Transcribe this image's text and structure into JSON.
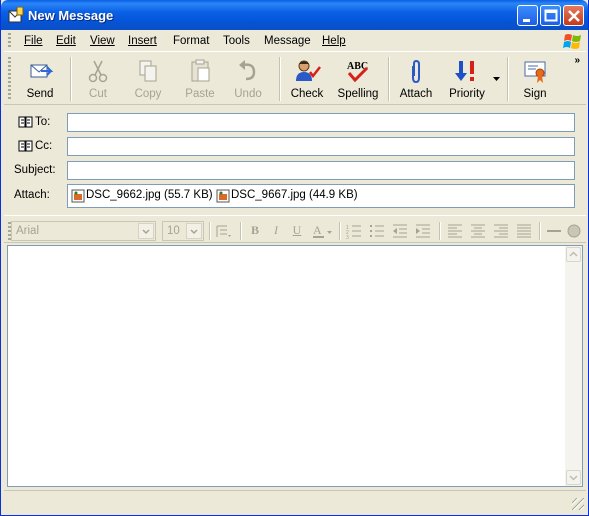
{
  "window": {
    "title": "New Message"
  },
  "menu": [
    "File",
    "Edit",
    "View",
    "Insert",
    "Format",
    "Tools",
    "Message",
    "Help"
  ],
  "toolbar": {
    "send": "Send",
    "cut": "Cut",
    "copy": "Copy",
    "paste": "Paste",
    "undo": "Undo",
    "check": "Check",
    "spelling": "Spelling",
    "attach": "Attach",
    "priority": "Priority",
    "sign": "Sign"
  },
  "header": {
    "to_label": "To:",
    "cc_label": "Cc:",
    "subject_label": "Subject:",
    "attach_label": "Attach:",
    "to_value": "",
    "cc_value": "",
    "subject_value": ""
  },
  "attachments": [
    {
      "name": "DSC_9662.jpg (55.7 KB)"
    },
    {
      "name": "DSC_9667.jpg (44.9 KB)"
    }
  ],
  "format": {
    "font": "Arial",
    "size": "10"
  },
  "icons": {
    "send": "send-icon",
    "cut": "scissors-icon",
    "copy": "copy-icon",
    "paste": "paste-icon",
    "undo": "undo-icon",
    "check": "check-names-icon",
    "spelling": "spelling-icon",
    "attach": "paperclip-icon",
    "priority": "priority-icon",
    "sign": "certificate-icon"
  }
}
